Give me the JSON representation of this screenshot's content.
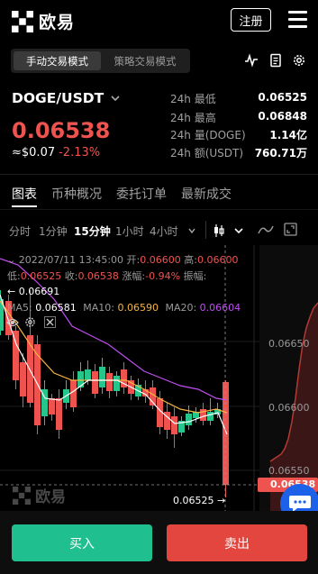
{
  "header": {
    "logo_name": "欧易",
    "register_label": "注册"
  },
  "mode_tabs": [
    {
      "label": "手动交易模式",
      "active": true
    },
    {
      "label": "策略交易模式",
      "active": false
    }
  ],
  "ticker": {
    "pair": "DOGE/USDT",
    "price": "0.06538",
    "usd_price": "≈$0.07",
    "change": "-2.13%"
  },
  "stats": [
    {
      "label": "24h 最低",
      "value": "0.06525"
    },
    {
      "label": "24h 最高",
      "value": "0.06848"
    },
    {
      "label": "24h 量(DOGE)",
      "value": "1.14亿"
    },
    {
      "label": "24h 额(USDT)",
      "value": "760.71万"
    }
  ],
  "tabs": [
    {
      "label": "图表",
      "active": true
    },
    {
      "label": "币种概况",
      "active": false
    },
    {
      "label": "委托订单",
      "active": false
    },
    {
      "label": "最新成交",
      "active": false
    }
  ],
  "intervals": [
    {
      "label": "分时",
      "active": false
    },
    {
      "label": "1分钟",
      "active": false
    },
    {
      "label": "15分钟",
      "active": true
    },
    {
      "label": "1小时",
      "active": false
    },
    {
      "label": "4小时",
      "active": false
    }
  ],
  "chart_info": {
    "datetime": "2022/07/11 13:45:00",
    "open_label": "开:",
    "open": "0.06600",
    "high_label": "高:",
    "high": "0.06600",
    "low_label": "低:",
    "low": "0.06525",
    "close_label": "收:",
    "close": "0.06538",
    "amp_change_label": "涨幅:",
    "amp_change": "-0.94%",
    "amplitude_label": "振幅:",
    "left_marker": "← 0.06691",
    "ma5_label": "MA5:",
    "ma5": "0.06581",
    "ma10_label": "MA10:",
    "ma10": "0.06590",
    "ma20_label": "MA20:",
    "ma20": "0.06604",
    "low_marker": "0.06525 →",
    "price_tag": "0.06538"
  },
  "chart_data": {
    "type": "candlestick",
    "yticks": [
      "0.06650",
      "0.06600",
      "0.06550"
    ],
    "colors": {
      "up": "#26c58c",
      "down": "#ef5350",
      "ma5": "#ffffff",
      "ma10": "#f5b642",
      "ma20": "#c04ef0"
    }
  },
  "buttons": {
    "buy": "买入",
    "sell": "卖出"
  }
}
